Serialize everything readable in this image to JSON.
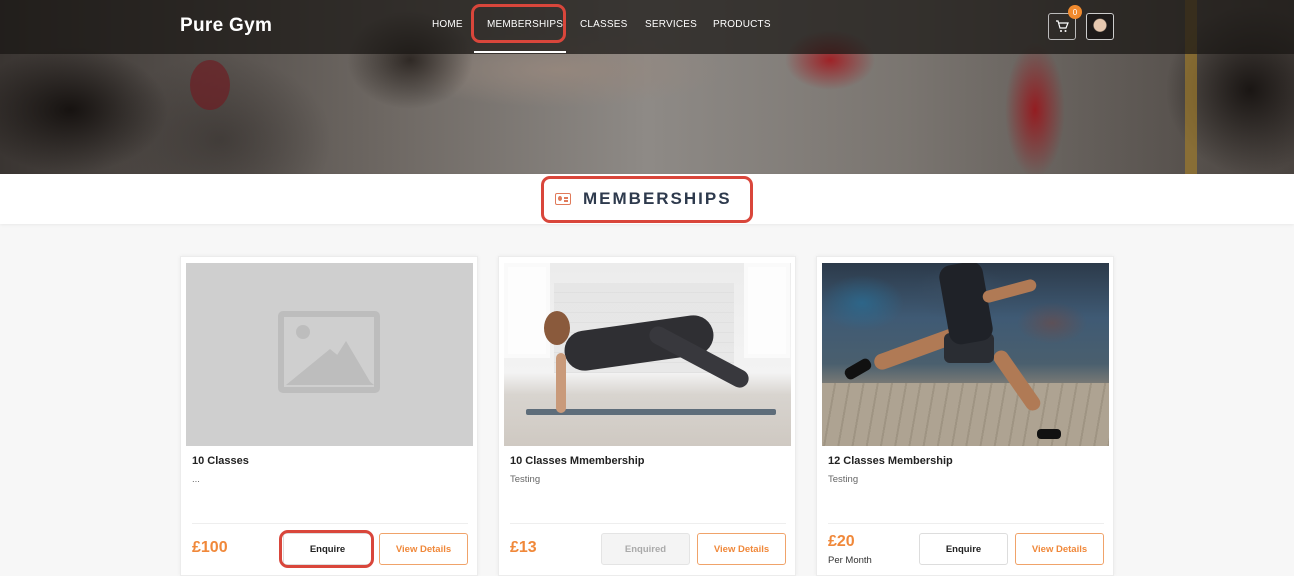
{
  "brand": "Pure Gym",
  "nav": {
    "items": [
      "HOME",
      "MEMBERSHIPS",
      "CLASSES",
      "SERVICES",
      "PRODUCTS"
    ],
    "active": "MEMBERSHIPS",
    "cart_count": "0"
  },
  "section": {
    "title": "MEMBERSHIPS"
  },
  "cards": [
    {
      "name": "10 Classes",
      "description": "...",
      "price": "£100",
      "period": "",
      "enquire_label": "Enquire",
      "enquire_enabled": true,
      "details_label": "View Details",
      "image": "placeholder-image-icon"
    },
    {
      "name": "10 Classes Mmembership",
      "description": "Testing",
      "price": "£13",
      "period": "",
      "enquire_label": "Enquired",
      "enquire_enabled": false,
      "details_label": "View Details",
      "image": "yoga-photo"
    },
    {
      "name": "12 Classes Membership",
      "description": "Testing",
      "price": "£20",
      "period": "Per Month",
      "enquire_label": "Enquire",
      "enquire_enabled": true,
      "details_label": "View Details",
      "image": "runner-photo"
    }
  ],
  "colors": {
    "accent": "#f0883a",
    "highlight": "#d9463b",
    "title": "#2e3a4d"
  }
}
